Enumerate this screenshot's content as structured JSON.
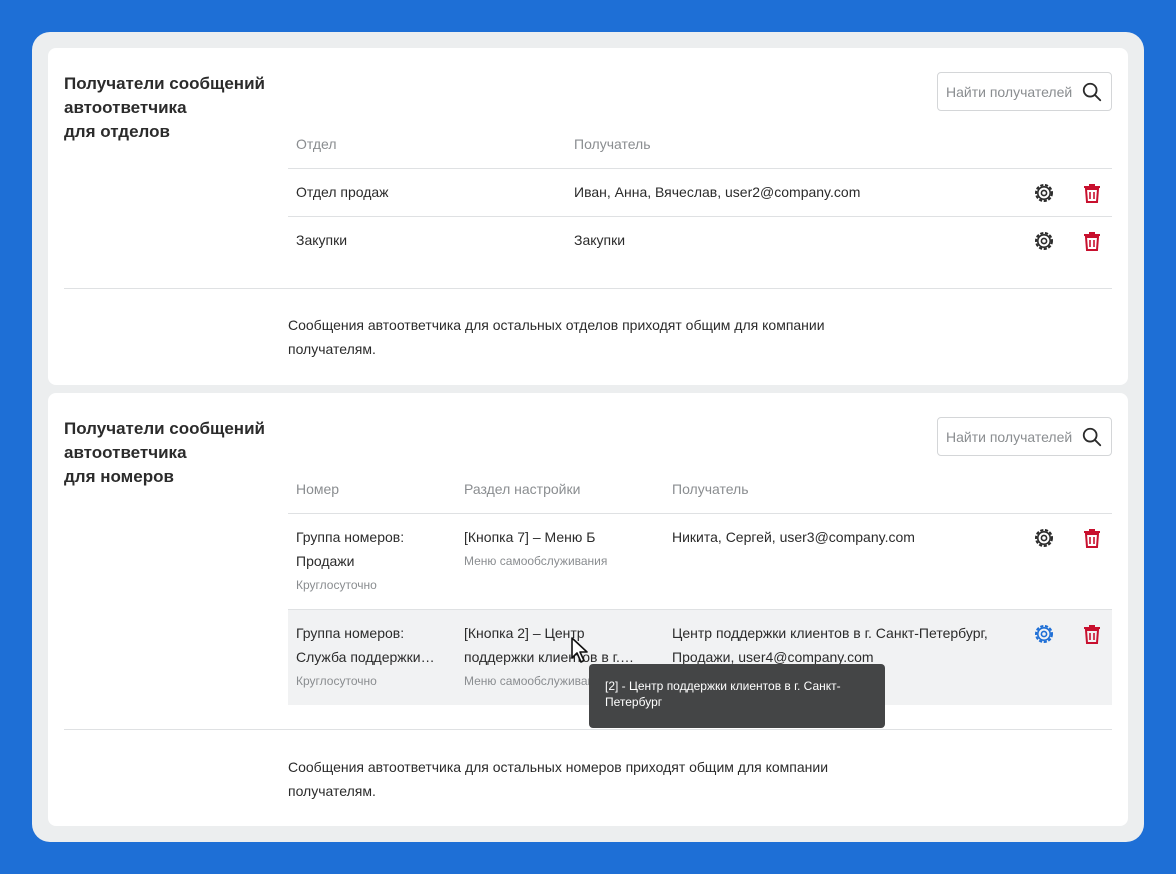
{
  "departments": {
    "title": "Получатели сообщений\nавтоответчика\nдля отделов",
    "search_placeholder": "Найти получателей",
    "columns": {
      "department": "Отдел",
      "recipient": "Получатель"
    },
    "rows": [
      {
        "department": "Отдел продаж",
        "recipient": "Иван, Анна, Вячеслав, user2@company.com"
      },
      {
        "department": "Закупки",
        "recipient": "Закупки"
      }
    ],
    "note": "Сообщения автоответчика для остальных отделов приходят общим для компании получателям."
  },
  "numbers": {
    "title": "Получатели сообщений\nавтоответчика\nдля номеров",
    "search_placeholder": "Найти получателей",
    "columns": {
      "number": "Номер",
      "section": "Раздел настройки",
      "recipient": "Получатель"
    },
    "rows": [
      {
        "number": "Группа номеров: Продажи",
        "number_sub": "Круглосуточно",
        "section": "[Кнопка 7] – Меню Б",
        "section_sub": "Меню самообслуживания",
        "recipient": "Никита, Сергей, user3@company.com"
      },
      {
        "number": "Группа номеров: Служба поддержки…",
        "number_sub": "Круглосуточно",
        "section": "[Кнопка 2] – Центр поддержки клиентов в г.…",
        "section_sub": "Меню самообслуживания",
        "recipient": "Центр поддержки клиентов в г. Санкт-Петербург, Продажи, user4@company.com"
      }
    ],
    "note": "Сообщения автоответчика для остальных номеров приходят общим для компании получателям."
  },
  "tooltip": "[2] - Центр поддержки клиентов в г. Санкт-Петербург",
  "colors": {
    "accent": "#1e6fd6",
    "danger": "#c8102e",
    "icon": "#2b2b2b"
  }
}
